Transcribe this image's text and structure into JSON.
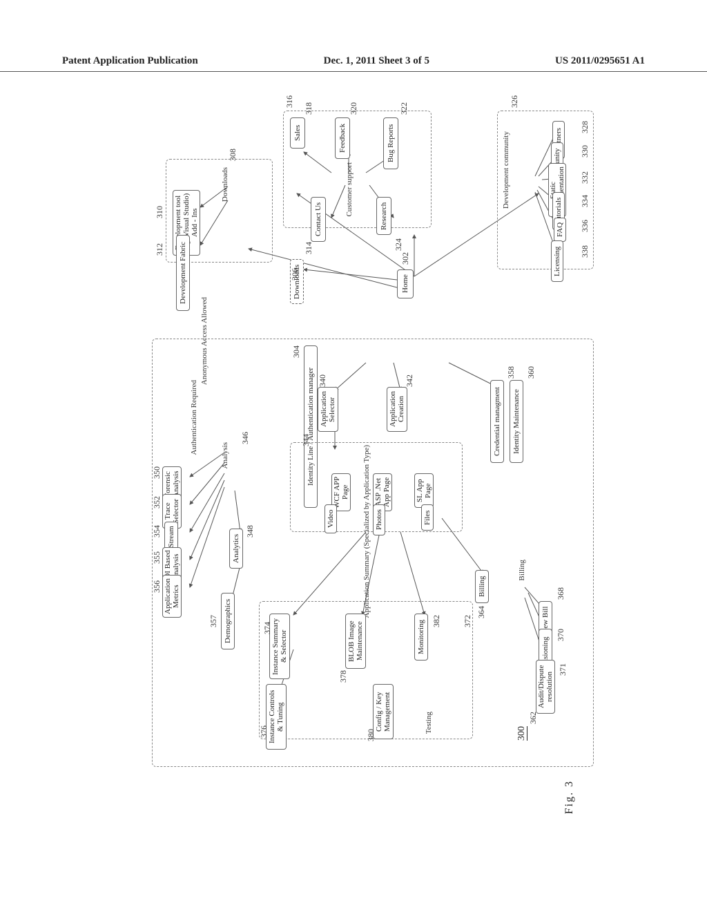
{
  "header": {
    "left": "Patent Application Publication",
    "center": "Dec. 1, 2011   Sheet 3 of 5",
    "right": "US 2011/0295651 A1"
  },
  "sheet_label_top": "Sheet 3 of 5",
  "figure_label": "Fig. 3",
  "scheme_ref": "300",
  "groups": {
    "customer_support": "Customer support",
    "dev_community": "Development community",
    "downloads": "Downloads",
    "auth_required": "Authentication Required",
    "anon_allowed": "Anonymous Access Allowed",
    "app_summary": "Application Summary\n(Specialized by Application Type)",
    "billing": "Billing",
    "analysis": "Analysis",
    "testing": "Testing"
  },
  "nodes": {
    "sales": "Sales",
    "feedback": "Feedback",
    "bug_reports": "Bug Reports",
    "contact_us": "Contact Us",
    "research": "Research",
    "partners": "Partners",
    "community": "Community",
    "static_doc": "Static\nDocumentation",
    "tutorials": "Tutorials",
    "faq": "FAQ",
    "licensing": "Licensing",
    "home": "Home",
    "downloads_node": "Downloads",
    "dev_tool": "Development tool\n(e.g. Visual Studio)\nAdd - Ins",
    "dev_fabric": "Development Fabric",
    "id_line": "Identity Line / Authentication manager",
    "app_selector": "Application\nSelector",
    "app_creation": "Application\nCreation",
    "cred_mgmt": "Credential managment",
    "id_maint": "Identity Maintenance",
    "wcf": "WCF APP\nPage",
    "asp": "ASP .Net\nApp Page",
    "sl": "SL App\nPage",
    "video": "Video",
    "photos": "Photos",
    "files": "Files",
    "forensic": "Forensic\nAnalysis",
    "trace": "Trace\nSelector",
    "click": "Click Stream",
    "roi": "ROI Based\nAnalysis",
    "app_metrics": "Application\nMetrics",
    "analytics": "Analytics",
    "demographics": "Demographics",
    "inst_summary": "Instance Summary\n& Selector",
    "inst_controls": "Instance Controls\n& Tuning",
    "blob": "BLOB Image\nMaintenance",
    "config": "Config / Key\nManagement",
    "monitoring": "Monitoring",
    "billing_node": "Billing",
    "view_bill": "View Bill",
    "bill_prov": "Billing Provisioning",
    "audit": "Audit/Dispute\nresolution"
  },
  "refs": {
    "r302": "302",
    "r304": "304",
    "r306": "306",
    "r308": "308",
    "r310": "310",
    "r312": "312",
    "r314": "314",
    "r316": "316",
    "r318": "318",
    "r320": "320",
    "r322": "322",
    "r324": "324",
    "r326": "326",
    "r328": "328",
    "r330": "330",
    "r332": "332",
    "r334": "334",
    "r336": "336",
    "r338": "338",
    "r340": "340",
    "r342": "342",
    "r344": "344",
    "r346": "346",
    "r348": "348",
    "r350": "350",
    "r352": "352",
    "r354": "354",
    "r355": "355",
    "r356": "356",
    "r357": "357",
    "r358": "358",
    "r360": "360",
    "r362": "362",
    "r364": "364",
    "r368": "368",
    "r370": "370",
    "r371": "371",
    "r372": "372",
    "r374": "374",
    "r376": "376",
    "r378": "378",
    "r380": "380",
    "r382": "382"
  }
}
